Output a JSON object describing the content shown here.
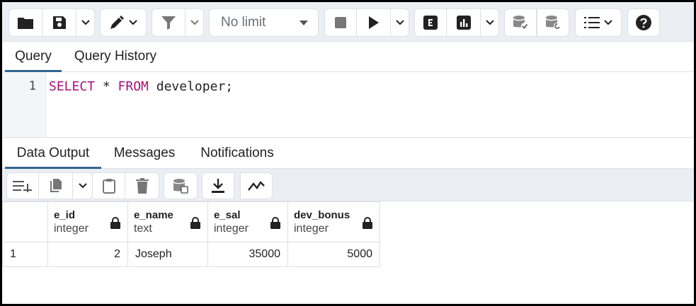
{
  "toolbar": {
    "limit_value": "No limit",
    "icons": [
      "folder-icon",
      "save-icon",
      "chevron-down-icon",
      "pen-icon",
      "filter-icon",
      "stop-icon",
      "play-icon",
      "explain-icon",
      "analyze-icon",
      "commit-icon",
      "rollback-icon",
      "macros-icon",
      "help-icon"
    ]
  },
  "query_tabs": [
    {
      "label": "Query",
      "active": true
    },
    {
      "label": "Query History",
      "active": false
    }
  ],
  "editor": {
    "line_number": "1",
    "tokens": {
      "kw1": "SELECT",
      "op": " * ",
      "kw2": "FROM",
      "rest": " developer;"
    }
  },
  "output_tabs": [
    {
      "label": "Data Output",
      "active": true
    },
    {
      "label": "Messages",
      "active": false
    },
    {
      "label": "Notifications",
      "active": false
    }
  ],
  "grid": {
    "columns": [
      {
        "name": "e_id",
        "type": "integer"
      },
      {
        "name": "e_name",
        "type": "text"
      },
      {
        "name": "e_sal",
        "type": "integer"
      },
      {
        "name": "dev_bonus",
        "type": "integer"
      }
    ],
    "rows": [
      {
        "row_no": "1",
        "cells": [
          "2",
          "Joseph",
          "35000",
          "5000"
        ]
      }
    ]
  },
  "colors": {
    "accent": "#326690",
    "keyword": "#a0127c",
    "toolbar_bg": "#ebeef3"
  }
}
